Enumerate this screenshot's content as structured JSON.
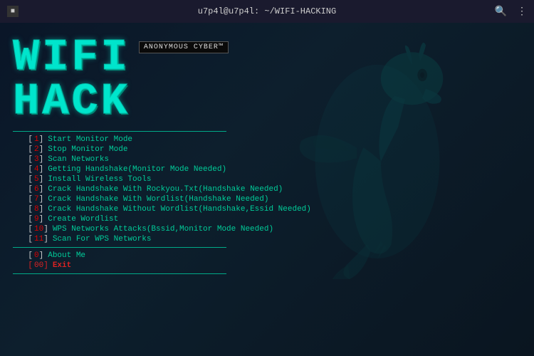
{
  "titlebar": {
    "icon_label": "■",
    "title": "u7p4l@u7p4l: ~/WIFI-HACKING",
    "search_icon": "🔍",
    "menu_icon": "⋮"
  },
  "badge": {
    "text": "ANONYMOUS CYBER™"
  },
  "logo": {
    "line1": "WIFI",
    "line2": "HACK"
  },
  "menu": {
    "items": [
      {
        "number": "1",
        "label": "Start Monitor Mode"
      },
      {
        "number": "2",
        "label": "Stop Monitor Mode"
      },
      {
        "number": "3",
        "label": "Scan Networks"
      },
      {
        "number": "4",
        "label": "Getting Handshake(Monitor Mode Needed)"
      },
      {
        "number": "5",
        "label": "Install Wireless Tools"
      },
      {
        "number": "6",
        "label": "Crack Handshake With Rockyou.Txt(Handshake Needed)"
      },
      {
        "number": "7",
        "label": "Crack Handshake With Wordlist(Handshake Needed)"
      },
      {
        "number": "8",
        "label": "Crack Handshake Without Wordlist(Handshake,Essid Needed)"
      },
      {
        "number": "9",
        "label": "Create Wordlist"
      },
      {
        "number": "10",
        "label": "WPS Networks Attacks(Bssid,Monitor Mode Needed)"
      },
      {
        "number": "11",
        "label": "Scan For WPS Networks"
      }
    ],
    "special": {
      "number": "0",
      "label": "About Me"
    },
    "exit": {
      "number": "00",
      "label": "Exit"
    }
  }
}
